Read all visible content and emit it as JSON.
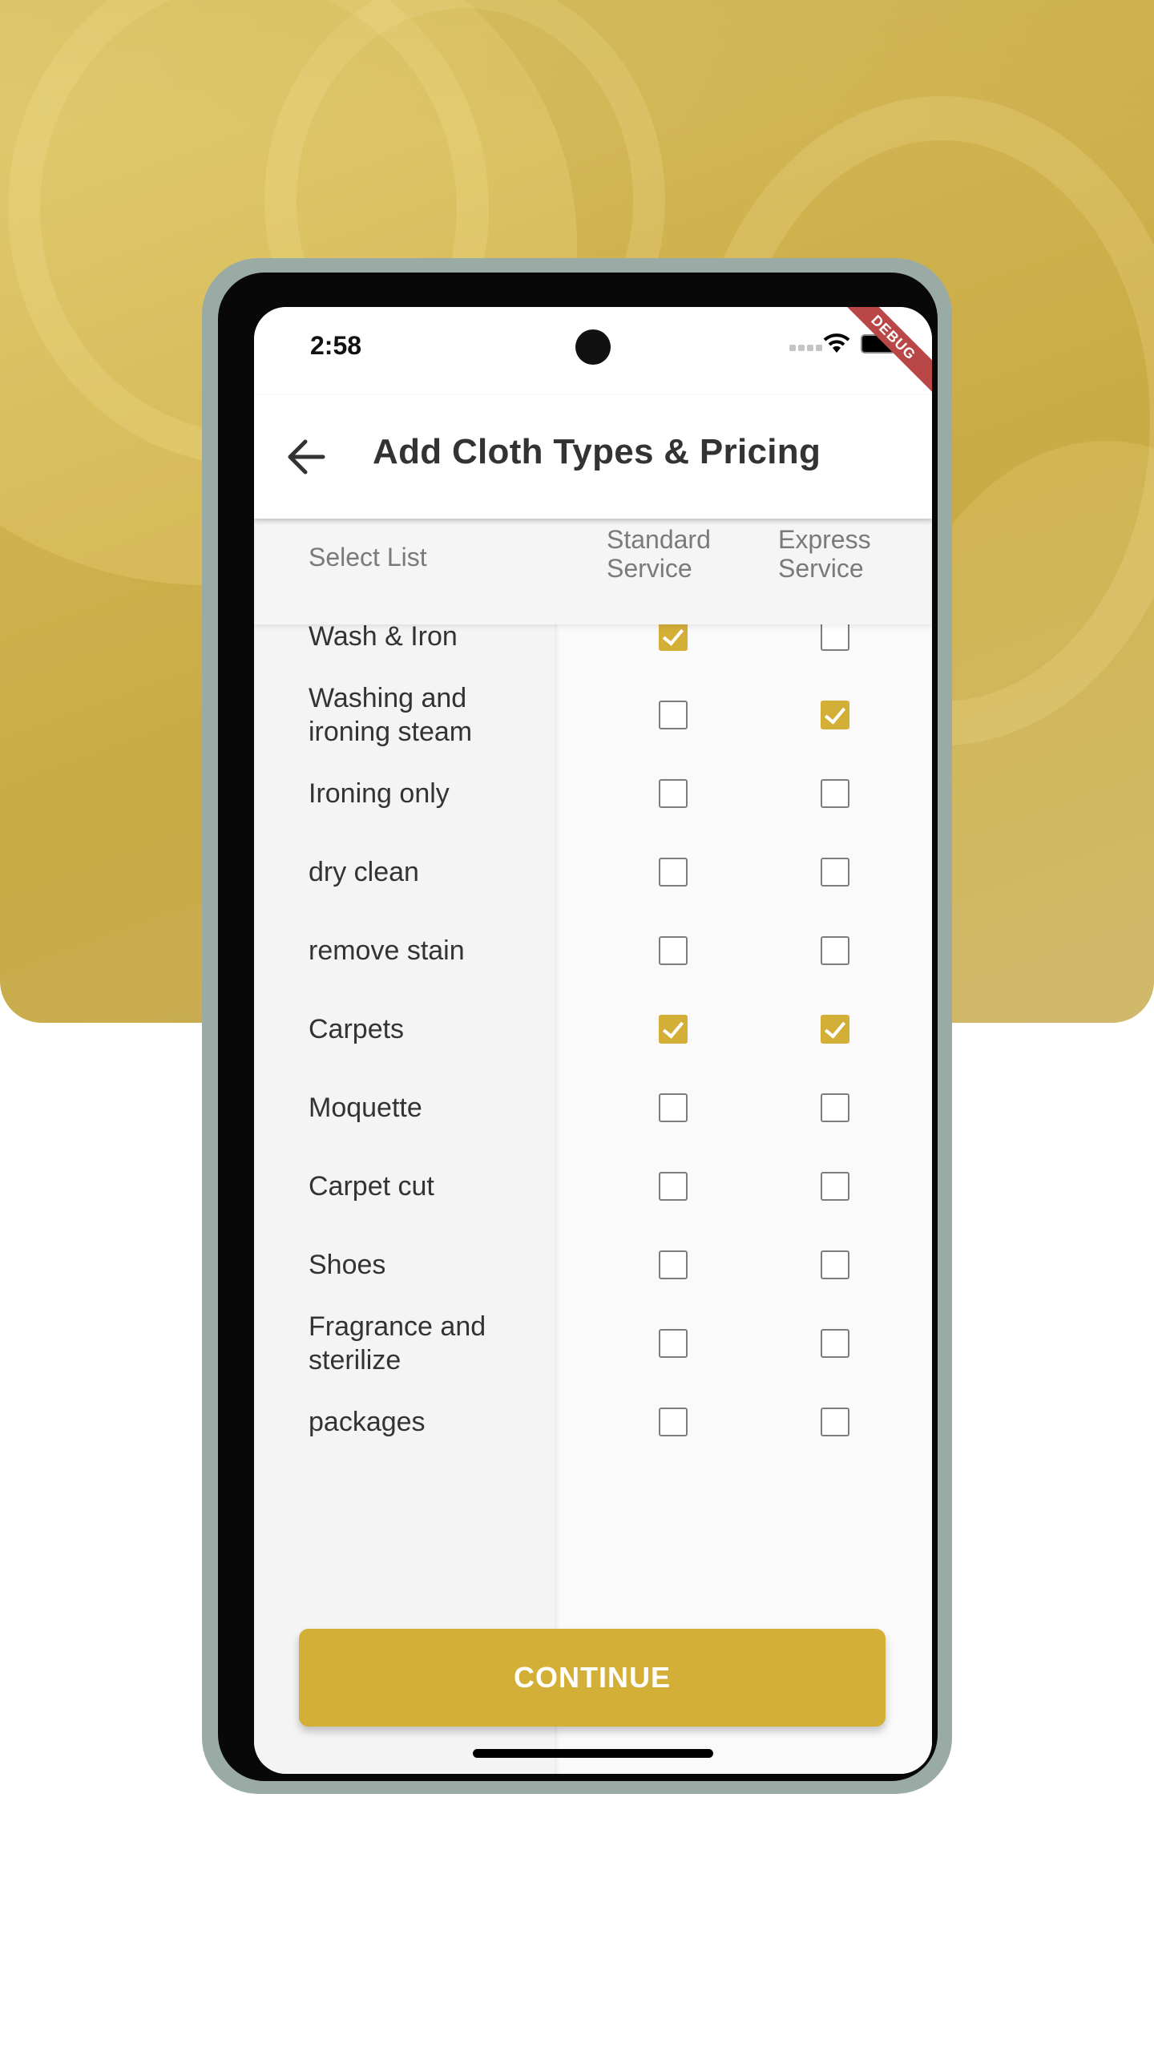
{
  "status_bar": {
    "time": "2:58",
    "debug_banner": "DEBUG"
  },
  "app_bar": {
    "title": "Add Cloth Types & Pricing",
    "back_icon": "arrow-left-icon"
  },
  "table": {
    "headers": {
      "select_list": "Select List",
      "standard": "Standard\nService",
      "express": "Express\nService"
    },
    "rows": [
      {
        "label": "Wash & Iron",
        "standard": true,
        "express": false
      },
      {
        "label": "Washing and\nironing steam",
        "standard": false,
        "express": true
      },
      {
        "label": "Ironing only",
        "standard": false,
        "express": false
      },
      {
        "label": "dry clean",
        "standard": false,
        "express": false
      },
      {
        "label": "remove stain",
        "standard": false,
        "express": false
      },
      {
        "label": "Carpets",
        "standard": true,
        "express": true
      },
      {
        "label": "Moquette",
        "standard": false,
        "express": false
      },
      {
        "label": "Carpet cut",
        "standard": false,
        "express": false
      },
      {
        "label": "Shoes",
        "standard": false,
        "express": false
      },
      {
        "label": "Fragrance and\nsterilize",
        "standard": false,
        "express": false
      },
      {
        "label": "packages",
        "standard": false,
        "express": false
      }
    ]
  },
  "continue_button": {
    "label": "CONTINUE"
  },
  "colors": {
    "accent": "#d4af37",
    "debug_ribbon": "#b94747",
    "frame_outer": "#9aaba6"
  }
}
